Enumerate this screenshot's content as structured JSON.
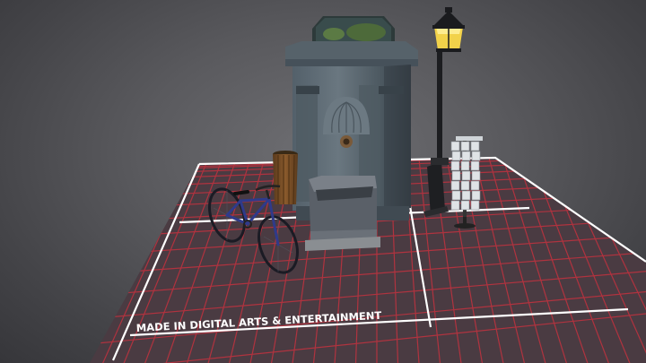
{
  "scene": {
    "floor_label": "MADE IN DIGITAL ARTS & ENTERTAINMENT",
    "objects": [
      "fountain",
      "street-lamp",
      "trash-bin",
      "bicycle",
      "postcard-rack"
    ]
  },
  "colors": {
    "background": "#4e4e52",
    "floor_tile": "#4a3b42",
    "floor_grid": "#c2323f",
    "floor_border": "#ffffff",
    "stone": "#5d6870",
    "lamp_glass": "#f2d24a"
  }
}
